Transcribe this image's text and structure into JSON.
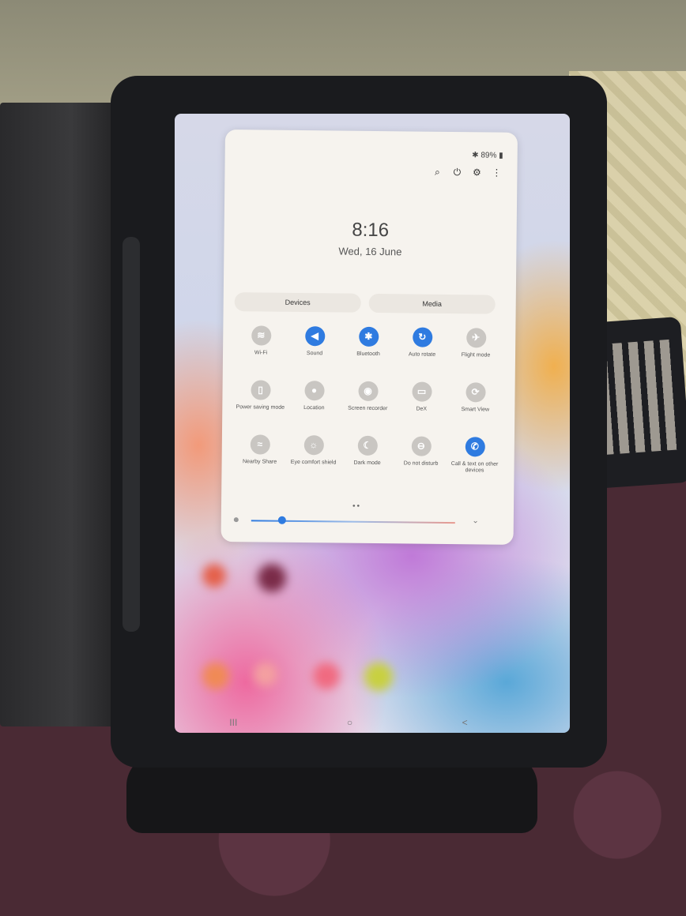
{
  "status_bar": {
    "bluetooth_icon": "bluetooth-icon",
    "battery": "89%"
  },
  "toolbar": {
    "icons": [
      "search-icon",
      "power-icon",
      "gear-icon",
      "more-icon"
    ]
  },
  "clock": {
    "time": "8:16",
    "date": "Wed, 16 June"
  },
  "tabs": {
    "devices": "Devices",
    "media": "Media"
  },
  "tiles": [
    {
      "label": "Wi-Fi",
      "icon": "wifi-icon",
      "on": false
    },
    {
      "label": "Sound",
      "icon": "sound-icon",
      "on": true
    },
    {
      "label": "Bluetooth",
      "icon": "bluetooth-icon",
      "on": true
    },
    {
      "label": "Auto rotate",
      "icon": "rotate-icon",
      "on": true
    },
    {
      "label": "Flight mode",
      "icon": "airplane-icon",
      "on": false
    },
    {
      "label": "Power saving mode",
      "icon": "battery-icon",
      "on": false
    },
    {
      "label": "Location",
      "icon": "location-icon",
      "on": false
    },
    {
      "label": "Screen recorder",
      "icon": "screen-recorder-icon",
      "on": false
    },
    {
      "label": "DeX",
      "icon": "dex-icon",
      "on": false
    },
    {
      "label": "Smart View",
      "icon": "smart-view-icon",
      "on": false
    },
    {
      "label": "Nearby Share",
      "icon": "nearby-share-icon",
      "on": false
    },
    {
      "label": "Eye comfort shield",
      "icon": "eye-comfort-icon",
      "on": false
    },
    {
      "label": "Dark mode",
      "icon": "moon-icon",
      "on": false
    },
    {
      "label": "Do not disturb",
      "icon": "do-not-disturb-icon",
      "on": false
    },
    {
      "label": "Call & text on other devices",
      "icon": "call-icon",
      "on": true
    }
  ],
  "brightness": {
    "level": 0.15
  },
  "nav": {
    "recents": "III",
    "home": "○",
    "back": "<"
  },
  "colors": {
    "accent": "#2f7be0",
    "tile_off": "#c9c6c2",
    "panel": "#f6f3ee"
  }
}
